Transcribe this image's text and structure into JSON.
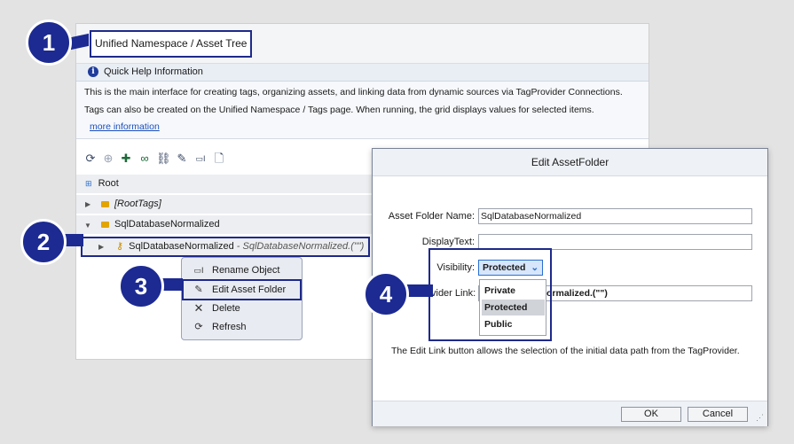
{
  "main": {
    "title": "Unified Namespace / Asset Tree",
    "quick_help": {
      "title": "Quick Help Information",
      "line1": "This is the main interface for creating tags, organizing assets, and linking data from dynamic sources via TagProvider Connections.",
      "line2": "Tags can also be created on the Unified Namespace / Tags page. When running, the grid displays values for selected items.",
      "link": "more information"
    },
    "toolbar_icons": [
      "refresh-icon",
      "add-folder-icon",
      "add-tag-icon",
      "add-link-icon",
      "edit-link-icon",
      "edit-icon",
      "rename-icon",
      "new-document-icon"
    ],
    "tree": {
      "root": "Root",
      "roottags": "[RootTags]",
      "folder": "SqlDatabaseNormalized",
      "child_name": "SqlDatabaseNormalized",
      "child_path": " - SqlDatabaseNormalized.(\"\")"
    },
    "context_menu": {
      "items": [
        {
          "label": "Rename Object",
          "icon": "rename-icon"
        },
        {
          "label": "Edit Asset Folder",
          "icon": "pencil-icon"
        },
        {
          "label": "Delete",
          "icon": "close-icon"
        },
        {
          "label": "Refresh",
          "icon": "refresh-icon"
        }
      ]
    }
  },
  "dialog": {
    "title": "Edit AssetFolder",
    "asset_folder_name_label": "Asset Folder Name:",
    "asset_folder_name_value": "SqlDatabaseNormalized",
    "display_text_label": "DisplayText:",
    "display_text_value": "",
    "visibility_label": "Visibility:",
    "visibility_value": "Protected",
    "visibility_options": [
      "Private",
      "Protected",
      "Public"
    ],
    "provider_link_label": "vider Link:",
    "provider_link_value": "ormalized.(\"\")",
    "note": "The Edit Link button allows the selection of the initial data path from the TagProvider.",
    "ok": "OK",
    "cancel": "Cancel"
  },
  "badges": [
    "1",
    "2",
    "3",
    "4"
  ]
}
